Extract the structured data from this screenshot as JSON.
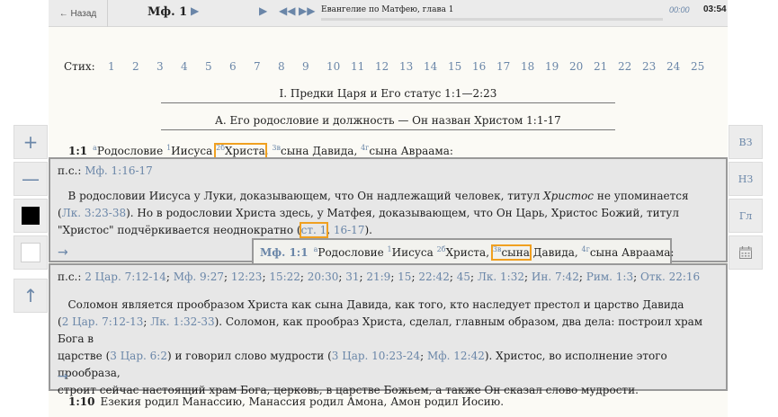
{
  "topbar": {
    "back_label": "← Назад",
    "chapter_label": "Мф. 1",
    "reading_title": "Евангелие по Матфею, глава 1",
    "elapsed": "00:00",
    "total": "03:54",
    "progress": 0.0
  },
  "verse_nav": {
    "label": "Стих:",
    "numbers": [
      "1",
      "2",
      "3",
      "4",
      "5",
      "6",
      "7",
      "8",
      "9",
      "10",
      "11",
      "12",
      "13",
      "14",
      "15",
      "16",
      "17",
      "18",
      "19",
      "20",
      "21",
      "22",
      "23",
      "24",
      "25"
    ]
  },
  "headings": {
    "h1": "I.    Предки Царя и Его статус 1:1—2:23",
    "h2": "A.    Его родословие и должность — Он назван Христом 1:1-17"
  },
  "verse1": {
    "num": "1:1",
    "fn_a": "a",
    "w1": "Родословие ",
    "fn_1": "1",
    "w2": "Иисуса ",
    "fn_2b": "2б",
    "w3": "Христа",
    "w3_after": ", ",
    "fn_3v": "3в",
    "w4": "сына Давида, ",
    "fn_4g": "4г",
    "w5": "сына Авраама:"
  },
  "popup1": {
    "refs_label": "п.с.: ",
    "ref1": "Мф. 1:16-17",
    "text_a": "В родословии Иисуса у Луки, доказывающем, что Он надлежащий человек, титул ",
    "text_italic": "Христос",
    "text_b": " не упоминается (",
    "ref_luke": "Лк. 3:23-38",
    "text_c": "). Но в родословии Христа здесь, у Матфея, доказывающем, что Он Царь, Христос Божий, титул \"Христос\" подчёркивается неоднократно (",
    "ref_st1": "ст. 1",
    "ref_sep": ", ",
    "ref_1617": "16-17",
    "text_d": ").",
    "arrow": "→"
  },
  "inner": {
    "num": "Мф. 1:1",
    "fn_a": "a",
    "w1": "Родословие ",
    "fn_1": "1",
    "w2": "Иисуса ",
    "fn_2b": "2б",
    "w3": "Христа, ",
    "fn_3v": "3в",
    "w4": "сына",
    "w5": " Давида, ",
    "fn_4g": "4г",
    "w6": "сына Авраама:"
  },
  "popup2": {
    "refs_label": "п.с.: ",
    "refs": [
      "2 Цар. 7:12-14",
      "Мф. 9:27",
      "12:23",
      "15:22",
      "20:30",
      "31",
      "21:9",
      "15",
      "22:42",
      "45",
      "Лк. 1:32",
      "Ин. 7:42",
      "Рим. 1:3",
      "Отк. 22:16"
    ],
    "p1": "Соломон является прообразом Христа как сына Давида, как того, кто наследует престол и царство Давида",
    "p2_a": "(",
    "ref_a": "2 Цар. 7:12-13",
    "p2_sep": "; ",
    "ref_b": "Лк. 1:32-33",
    "p2_b": "). Соломон, как прообраз Христа, сделал, главным образом, два дела: построил храм Бога в",
    "p3_a": "царстве (",
    "ref_c": "3 Цар. 6:2",
    "p3_b": ") и говорил слово мудрости (",
    "ref_d": "3 Цар. 10:23-24",
    "p3_sep": "; ",
    "ref_e": "Мф. 12:42",
    "p3_c": "). Христос, во исполнение этого прообраза,",
    "p4": "строит сейчас настоящий храм Бога, церковь, в царстве Божьем, а также Он сказал слово мудрости.",
    "arrow": "→"
  },
  "verse10": {
    "num": "1:10",
    "text": "Езекия родил Манассию, Манассия родил Амона, Амон родил Иосию."
  },
  "left_buttons": {
    "plus": "+",
    "minus": "—",
    "up": "↑"
  },
  "right_buttons": {
    "b1": "ВЗ",
    "b2": "НЗ",
    "b3": "Гл"
  },
  "colors": {
    "link": "#6a86a8",
    "highlight": "#f0a020",
    "page_bg": "#fbfaf5"
  }
}
